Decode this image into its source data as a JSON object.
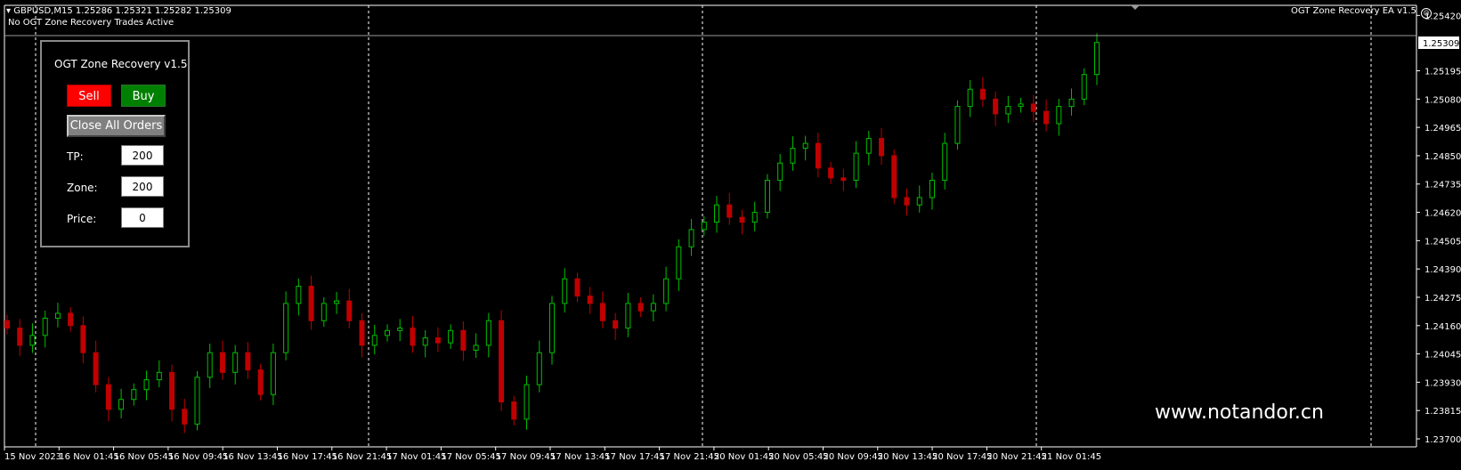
{
  "header": {
    "symbol_line": "GBPUSD,M15  1.25286 1.25321 1.25282 1.25309",
    "status_line": "No OGT Zone Recovery Trades Active",
    "ea_label": "OGT Zone Recovery EA  v1.5",
    "ea_icon": "smiley-icon"
  },
  "panel": {
    "title": "OGT Zone Recovery v1.5",
    "sell_label": "Sell",
    "buy_label": "Buy",
    "close_label": "Close All Orders",
    "tp_label": "TP:",
    "tp_value": "200",
    "zone_label": "Zone:",
    "zone_value": "200",
    "price_label": "Price:",
    "price_value": "0"
  },
  "watermark": "www.notandor.cn",
  "colors": {
    "bull": "#00c000",
    "bear": "#c00000",
    "grid": "#ffffff",
    "background": "#000000",
    "sell": "#ff0000",
    "buy": "#008000"
  },
  "chart_data": {
    "type": "candlestick",
    "symbol": "GBPUSD",
    "timeframe": "M15",
    "current_price": "1.25309",
    "ylim": [
      1.237,
      1.2545
    ],
    "y_ticks": [
      "1.25420",
      "1.25195",
      "1.25080",
      "1.24965",
      "1.24850",
      "1.24735",
      "1.24620",
      "1.24505",
      "1.24390",
      "1.24275",
      "1.24160",
      "1.24045",
      "1.23930",
      "1.23815",
      "1.23700"
    ],
    "x_ticks": [
      "15 Nov 2023",
      "16 Nov 01:45",
      "16 Nov 05:45",
      "16 Nov 09:45",
      "16 Nov 13:45",
      "16 Nov 17:45",
      "16 Nov 21:45",
      "17 Nov 01:45",
      "17 Nov 05:45",
      "17 Nov 09:45",
      "17 Nov 13:45",
      "17 Nov 17:45",
      "17 Nov 21:45",
      "20 Nov 01:45",
      "20 Nov 05:45",
      "20 Nov 09:45",
      "20 Nov 13:45",
      "20 Nov 17:45",
      "20 Nov 21:45",
      "21 Nov 01:45"
    ],
    "closes": [
      1.2415,
      1.2408,
      1.2412,
      1.2419,
      1.2421,
      1.2416,
      1.2405,
      1.2392,
      1.2382,
      1.2386,
      1.239,
      1.2394,
      1.2397,
      1.2382,
      1.2376,
      1.2395,
      1.2405,
      1.2397,
      1.2405,
      1.2398,
      1.2388,
      1.2405,
      1.2425,
      1.2432,
      1.2418,
      1.2425,
      1.2426,
      1.2418,
      1.2408,
      1.2412,
      1.2414,
      1.2415,
      1.2408,
      1.2411,
      1.2409,
      1.2414,
      1.2406,
      1.2408,
      1.2418,
      1.2385,
      1.2378,
      1.2392,
      1.2405,
      1.2425,
      1.2435,
      1.2428,
      1.2425,
      1.2418,
      1.2415,
      1.2425,
      1.2422,
      1.2425,
      1.2435,
      1.2448,
      1.2455,
      1.2458,
      1.2465,
      1.246,
      1.2458,
      1.2462,
      1.2475,
      1.2482,
      1.2488,
      1.249,
      1.248,
      1.2476,
      1.2475,
      1.2486,
      1.2492,
      1.2485,
      1.2468,
      1.2465,
      1.2468,
      1.2475,
      1.249,
      1.2505,
      1.2512,
      1.2508,
      1.2502,
      1.2505,
      1.2506,
      1.2503,
      1.2498,
      1.2505,
      1.2508,
      1.2518,
      1.2531
    ]
  }
}
